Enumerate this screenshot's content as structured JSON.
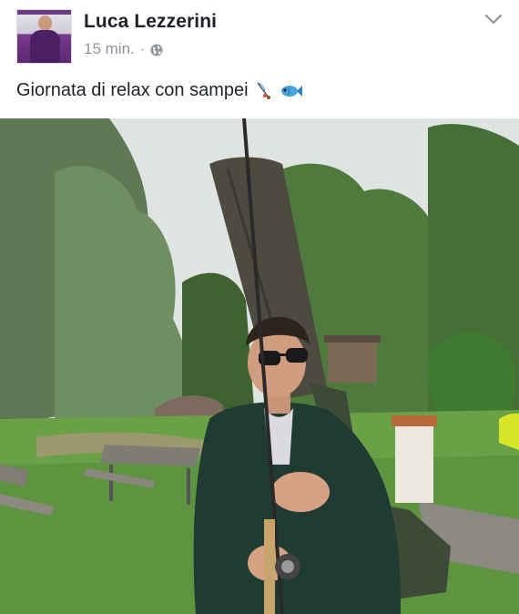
{
  "post": {
    "author": "Luca Lezzerini",
    "time": "15 min.",
    "separator": "·",
    "privacy_icon": "globe-icon",
    "menu_icon": "chevron-down-icon",
    "text": "Giornata di relax con sampei",
    "emojis": [
      "fishing-pole-icon",
      "fish-icon"
    ]
  }
}
